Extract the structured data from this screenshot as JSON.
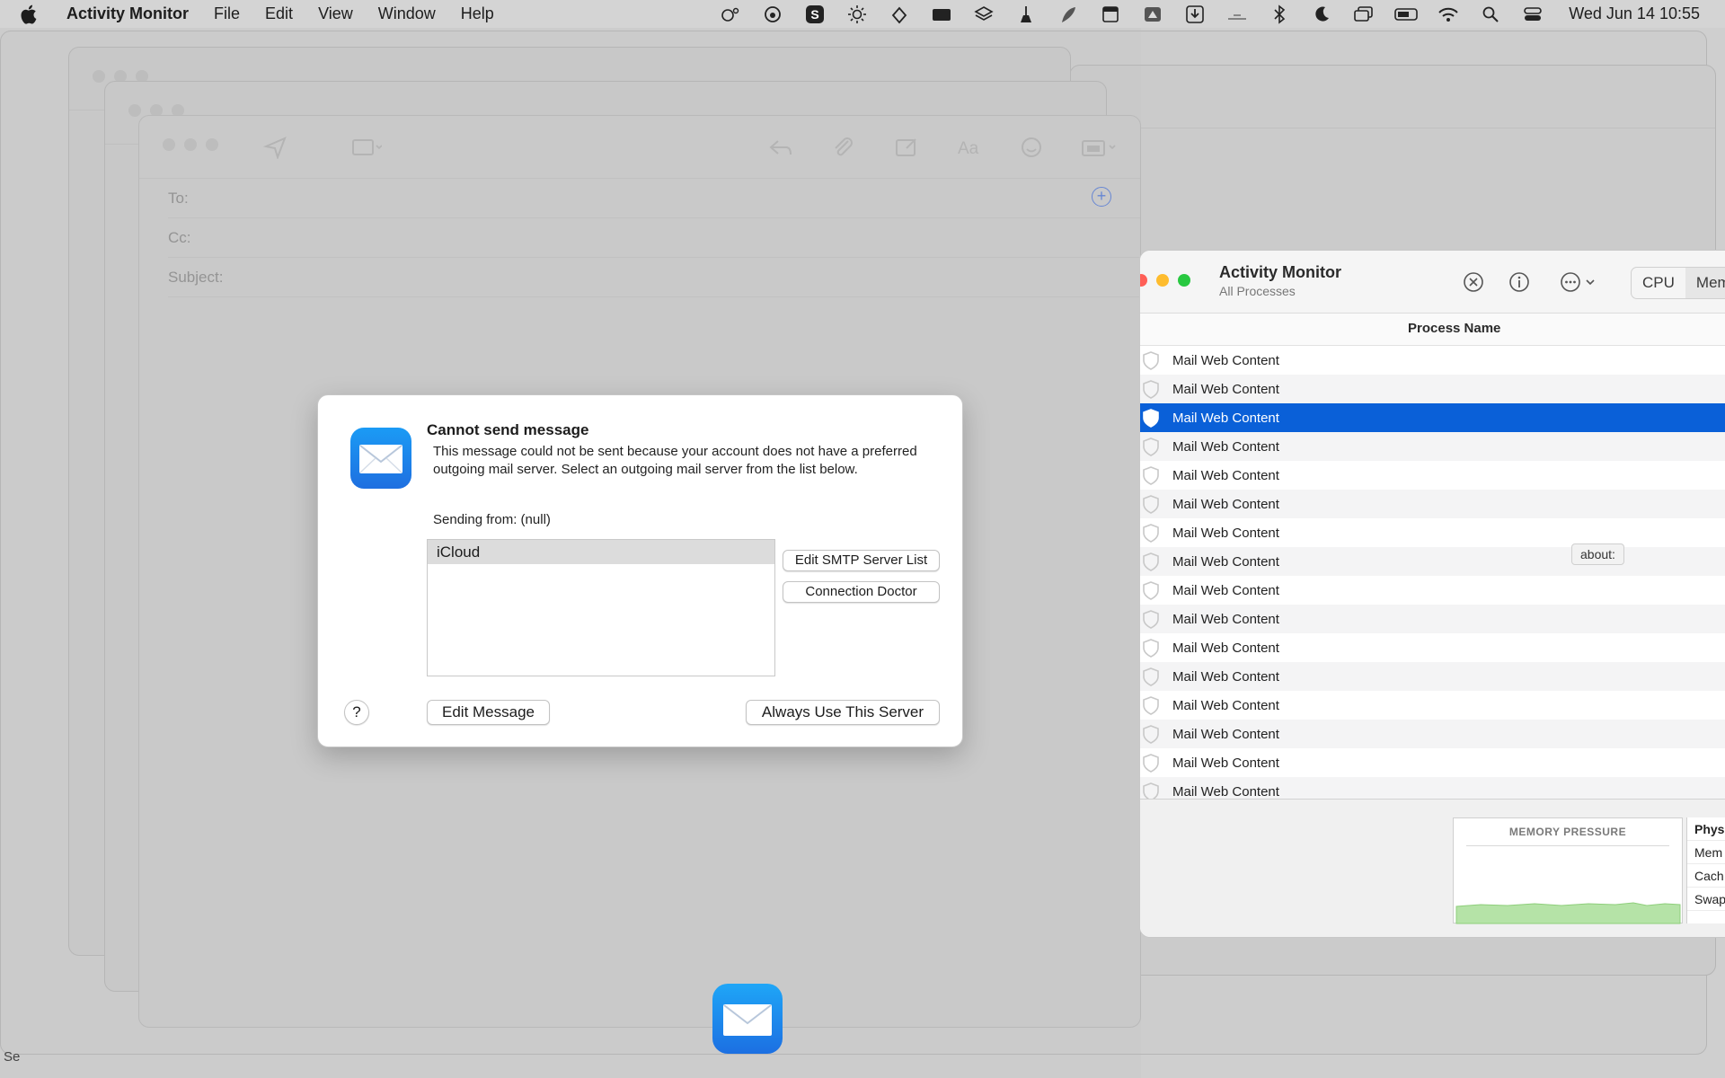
{
  "menubar": {
    "app_name": "Activity Monitor",
    "menus": [
      "File",
      "Edit",
      "View",
      "Window",
      "Help"
    ],
    "clock": "Wed Jun 14  10:55"
  },
  "compose": {
    "to_label": "To:",
    "cc_label": "Cc:",
    "subject_label": "Subject:"
  },
  "dialog": {
    "title": "Cannot send message",
    "message": "This message could not be sent because your account does not have a preferred outgoing mail server. Select an outgoing mail server from the list below.",
    "sending_from": "Sending from: (null)",
    "servers": [
      "iCloud"
    ],
    "edit_smtp_label": "Edit SMTP Server List",
    "connection_doctor_label": "Connection Doctor",
    "help_label": "?",
    "edit_message_label": "Edit Message",
    "always_use_label": "Always Use This Server"
  },
  "activity_monitor": {
    "title": "Activity Monitor",
    "subtitle": "All Processes",
    "tabs": [
      "CPU",
      "Mem"
    ],
    "column_header": "Process Name",
    "processes": [
      "Mail Web Content",
      "Mail Web Content",
      "Mail Web Content",
      "Mail Web Content",
      "Mail Web Content",
      "Mail Web Content",
      "Mail Web Content",
      "Mail Web Content",
      "Mail Web Content",
      "Mail Web Content",
      "Mail Web Content",
      "Mail Web Content",
      "Mail Web Content",
      "Mail Web Content",
      "Mail Web Content",
      "Mail Web Content"
    ],
    "selected_index": 2,
    "tooltip": "about:",
    "memory_pressure_title": "MEMORY PRESSURE",
    "memory_labels": [
      "Phys",
      "Mem",
      "Cach",
      "Swap"
    ]
  },
  "desktop": {
    "corner_label": "Se"
  },
  "colors": {
    "selection": "#0a60d8",
    "accent_link": "#5b7fd6",
    "memory_green": "#b5e3a7"
  }
}
